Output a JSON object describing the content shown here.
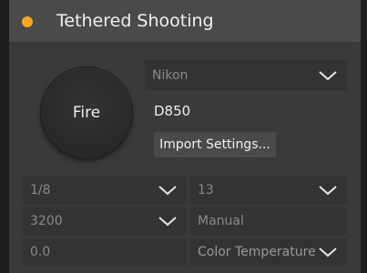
{
  "panel": {
    "title": "Tethered Shooting",
    "status_color": "#f5a623"
  },
  "fire": {
    "label": "Fire"
  },
  "camera": {
    "brand": "Nikon",
    "model": "D850",
    "import_label": "Import Settings..."
  },
  "controls": {
    "shutter": "1/8",
    "aperture": "13",
    "iso": "3200",
    "mode": "Manual",
    "exposure_comp": "0.0",
    "white_balance": "Color Temperature"
  },
  "icons": {
    "dropdown": "chevron-down-icon"
  }
}
